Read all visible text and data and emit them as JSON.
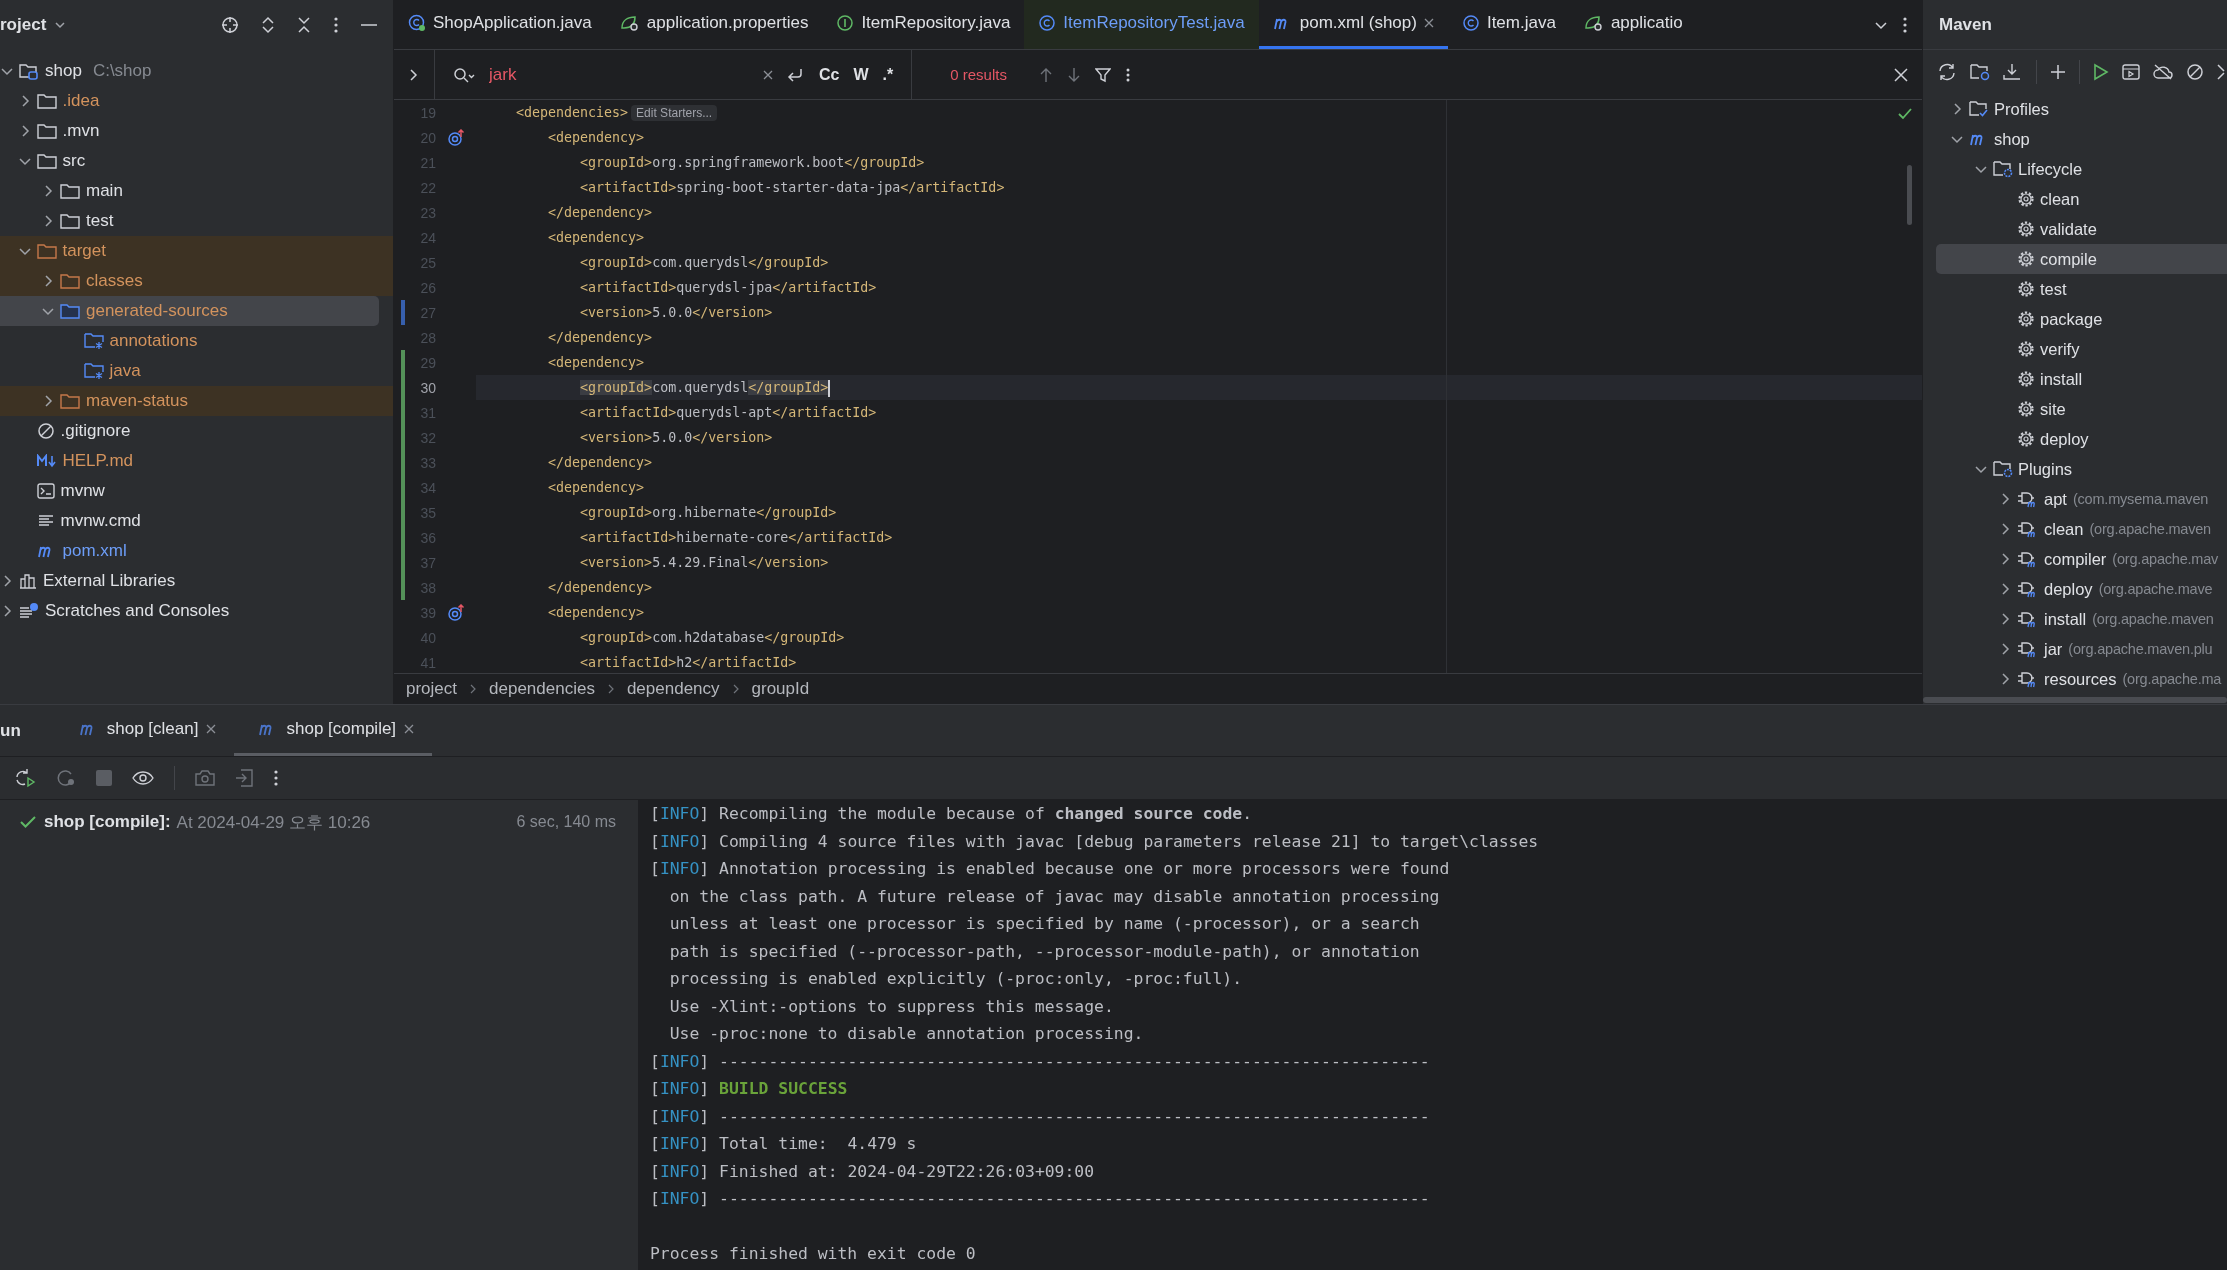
{
  "project": {
    "title": "roject",
    "tree": [
      {
        "name": "shop",
        "path": "C:\\shop",
        "kind": "module",
        "ignored": false,
        "modified": false,
        "expanded": true,
        "selected": false,
        "excluded": false,
        "children": [
          {
            "name": ".idea",
            "kind": "folder",
            "ignored": true,
            "modified": false,
            "expanded": false,
            "selected": false,
            "excluded": false
          },
          {
            "name": ".mvn",
            "kind": "folder",
            "ignored": false,
            "modified": false,
            "expanded": false,
            "selected": false,
            "excluded": false
          },
          {
            "name": "src",
            "kind": "folder",
            "ignored": false,
            "modified": false,
            "expanded": true,
            "selected": false,
            "excluded": false,
            "children": [
              {
                "name": "main",
                "kind": "folder",
                "ignored": false,
                "modified": false,
                "expanded": false,
                "selected": false,
                "excluded": false
              },
              {
                "name": "test",
                "kind": "folder",
                "ignored": false,
                "modified": false,
                "expanded": false,
                "selected": false,
                "excluded": false
              }
            ]
          },
          {
            "name": "target",
            "kind": "excluded-folder",
            "ignored": true,
            "modified": false,
            "expanded": true,
            "selected": false,
            "excluded": true,
            "children": [
              {
                "name": "classes",
                "kind": "excluded-folder",
                "ignored": true,
                "modified": false,
                "expanded": false,
                "selected": false,
                "excluded": true
              },
              {
                "name": "generated-sources",
                "kind": "source-folder",
                "ignored": true,
                "modified": false,
                "expanded": true,
                "selected": true,
                "excluded": false,
                "children": [
                  {
                    "name": "annotations",
                    "kind": "generated-root",
                    "ignored": true,
                    "modified": false,
                    "selected": false,
                    "excluded": false
                  },
                  {
                    "name": "java",
                    "kind": "generated-root",
                    "ignored": true,
                    "modified": false,
                    "selected": false,
                    "excluded": false
                  }
                ]
              },
              {
                "name": "maven-status",
                "kind": "excluded-folder",
                "ignored": true,
                "modified": false,
                "expanded": false,
                "selected": false,
                "excluded": true
              }
            ]
          },
          {
            "name": ".gitignore",
            "kind": "ignore-file",
            "ignored": false,
            "modified": false,
            "selected": false,
            "excluded": false
          },
          {
            "name": "HELP.md",
            "kind": "markdown",
            "ignored": true,
            "modified": false,
            "selected": false,
            "excluded": false
          },
          {
            "name": "mvnw",
            "kind": "script",
            "ignored": false,
            "modified": false,
            "selected": false,
            "excluded": false
          },
          {
            "name": "mvnw.cmd",
            "kind": "text-file",
            "ignored": false,
            "modified": false,
            "selected": false,
            "excluded": false
          },
          {
            "name": "pom.xml",
            "kind": "maven",
            "ignored": false,
            "modified": true,
            "selected": false,
            "excluded": false
          }
        ]
      },
      {
        "name": "External Libraries",
        "kind": "libraries",
        "ignored": false,
        "modified": false,
        "expanded": false,
        "selected": false,
        "excluded": false
      },
      {
        "name": "Scratches and Consoles",
        "kind": "scratches",
        "ignored": false,
        "modified": false,
        "expanded": false,
        "selected": false,
        "excluded": false
      }
    ]
  },
  "editor": {
    "tabs": [
      {
        "label": "ShopApplication.java",
        "kind": "spring-class",
        "selected": false,
        "test": false
      },
      {
        "label": "application.properties",
        "kind": "properties",
        "selected": false,
        "test": false
      },
      {
        "label": "ItemRepository.java",
        "kind": "interface",
        "selected": false,
        "test": false
      },
      {
        "label": "ItemRepositoryTest.java",
        "kind": "class",
        "selected": false,
        "test": true
      },
      {
        "label": "pom.xml (shop)",
        "kind": "maven",
        "selected": true,
        "test": false
      },
      {
        "label": "Item.java",
        "kind": "class",
        "selected": false,
        "test": false
      },
      {
        "label": "applicatio",
        "kind": "properties",
        "selected": false,
        "test": false
      }
    ],
    "find": {
      "query": "jark",
      "options": [
        "Cc",
        "W",
        ".*"
      ],
      "results": "0 results"
    },
    "lines": [
      {
        "number": "19",
        "text": "    <dependencies>",
        "inlay": "Edit Starters...",
        "current": false,
        "added": false,
        "modified": false,
        "marker": false
      },
      {
        "number": "20",
        "text": "        <dependency>",
        "current": false,
        "added": false,
        "modified": false,
        "marker": true
      },
      {
        "number": "21",
        "text": "            <groupId>org.springframework.boot</groupId>",
        "current": false,
        "added": false,
        "modified": false,
        "marker": false
      },
      {
        "number": "22",
        "text": "            <artifactId>spring-boot-starter-data-jpa</artifactId>",
        "current": false,
        "added": false,
        "modified": false,
        "marker": false
      },
      {
        "number": "23",
        "text": "        </dependency>",
        "current": false,
        "added": false,
        "modified": false,
        "marker": false
      },
      {
        "number": "24",
        "text": "        <dependency>",
        "current": false,
        "added": false,
        "modified": false,
        "marker": false
      },
      {
        "number": "25",
        "text": "            <groupId>com.querydsl</groupId>",
        "current": false,
        "added": false,
        "modified": false,
        "marker": false
      },
      {
        "number": "26",
        "text": "            <artifactId>querydsl-jpa</artifactId>",
        "current": false,
        "added": false,
        "modified": false,
        "marker": false
      },
      {
        "number": "27",
        "text": "            <version>5.0.0</version>",
        "current": false,
        "added": false,
        "modified": true,
        "marker": false
      },
      {
        "number": "28",
        "text": "        </dependency>",
        "current": false,
        "added": false,
        "modified": false,
        "marker": false
      },
      {
        "number": "29",
        "text": "        <dependency>",
        "current": false,
        "added": true,
        "modified": false,
        "marker": false
      },
      {
        "number": "30",
        "text": "            <groupId>com.querydsl</groupId>",
        "current": true,
        "added": true,
        "modified": false,
        "marker": false
      },
      {
        "number": "31",
        "text": "            <artifactId>querydsl-apt</artifactId>",
        "current": false,
        "added": true,
        "modified": false,
        "marker": false
      },
      {
        "number": "32",
        "text": "            <version>5.0.0</version>",
        "current": false,
        "added": true,
        "modified": false,
        "marker": false
      },
      {
        "number": "33",
        "text": "        </dependency>",
        "current": false,
        "added": true,
        "modified": false,
        "marker": false
      },
      {
        "number": "34",
        "text": "        <dependency>",
        "current": false,
        "added": true,
        "modified": false,
        "marker": false
      },
      {
        "number": "35",
        "text": "            <groupId>org.hibernate</groupId>",
        "current": false,
        "added": true,
        "modified": false,
        "marker": false
      },
      {
        "number": "36",
        "text": "            <artifactId>hibernate-core</artifactId>",
        "current": false,
        "added": true,
        "modified": false,
        "marker": false
      },
      {
        "number": "37",
        "text": "            <version>5.4.29.Final</version>",
        "current": false,
        "added": true,
        "modified": false,
        "marker": false
      },
      {
        "number": "38",
        "text": "        </dependency>",
        "current": false,
        "added": true,
        "modified": false,
        "marker": false
      },
      {
        "number": "39",
        "text": "        <dependency>",
        "current": false,
        "added": false,
        "modified": false,
        "marker": true
      },
      {
        "number": "40",
        "text": "            <groupId>com.h2database</groupId>",
        "current": false,
        "added": false,
        "modified": false,
        "marker": false
      },
      {
        "number": "41",
        "text": "            <artifactId>h2</artifactId>",
        "current": false,
        "added": false,
        "modified": false,
        "marker": false
      }
    ],
    "breadcrumbs": [
      "project",
      "dependencies",
      "dependency",
      "groupId"
    ]
  },
  "maven": {
    "title": "Maven",
    "tree": [
      {
        "name": "Profiles",
        "kind": "profiles",
        "expanded": false,
        "selected": false
      },
      {
        "name": "shop",
        "kind": "maven-project",
        "expanded": true,
        "selected": false,
        "children": [
          {
            "name": "Lifecycle",
            "kind": "lifecycle",
            "expanded": true,
            "selected": false,
            "children": [
              {
                "name": "clean",
                "kind": "goal",
                "selected": false
              },
              {
                "name": "validate",
                "kind": "goal",
                "selected": false
              },
              {
                "name": "compile",
                "kind": "goal",
                "selected": true
              },
              {
                "name": "test",
                "kind": "goal",
                "selected": false
              },
              {
                "name": "package",
                "kind": "goal",
                "selected": false
              },
              {
                "name": "verify",
                "kind": "goal",
                "selected": false
              },
              {
                "name": "install",
                "kind": "goal",
                "selected": false
              },
              {
                "name": "site",
                "kind": "goal",
                "selected": false
              },
              {
                "name": "deploy",
                "kind": "goal",
                "selected": false
              }
            ]
          },
          {
            "name": "Plugins",
            "kind": "lifecycle",
            "expanded": true,
            "selected": false,
            "children": [
              {
                "name": "apt",
                "detail": "(com.mysema.maven",
                "kind": "plugin",
                "expanded": false,
                "selected": false
              },
              {
                "name": "clean",
                "detail": "(org.apache.maven",
                "kind": "plugin",
                "expanded": false,
                "selected": false
              },
              {
                "name": "compiler",
                "detail": "(org.apache.mav",
                "kind": "plugin",
                "expanded": false,
                "selected": false
              },
              {
                "name": "deploy",
                "detail": "(org.apache.mave",
                "kind": "plugin",
                "expanded": false,
                "selected": false
              },
              {
                "name": "install",
                "detail": "(org.apache.maven",
                "kind": "plugin",
                "expanded": false,
                "selected": false
              },
              {
                "name": "jar",
                "detail": "(org.apache.maven.plu",
                "kind": "plugin",
                "expanded": false,
                "selected": false
              },
              {
                "name": "resources",
                "detail": "(org.apache.ma",
                "kind": "plugin",
                "expanded": false,
                "selected": false
              }
            ]
          }
        ]
      }
    ]
  },
  "run": {
    "title": "un",
    "tabs": [
      {
        "label": "shop [clean]",
        "selected": false
      },
      {
        "label": "shop [compile]",
        "selected": true
      }
    ],
    "result": {
      "name": "shop [compile]:",
      "detail": "At 2024-04-29 오후 10:26",
      "duration": "6 sec, 140 ms",
      "succeeded": true
    },
    "console": [
      {
        "prefix": "[INFO]",
        "text": "Recompiling the module because of **changed source code**.",
        "kind": "plain"
      },
      {
        "prefix": "[INFO]",
        "text": "Compiling 4 source files with javac [debug parameters release 21] to target\\classes",
        "kind": "plain"
      },
      {
        "prefix": "[INFO]",
        "text": "Annotation processing is enabled because one or more processors were found",
        "kind": "plain"
      },
      {
        "text": "  on the class path. A future release of javac may disable annotation processing",
        "kind": "plain"
      },
      {
        "text": "  unless at least one processor is specified by name (-processor), or a search",
        "kind": "plain"
      },
      {
        "text": "  path is specified (--processor-path, --processor-module-path), or annotation",
        "kind": "plain"
      },
      {
        "text": "  processing is enabled explicitly (-proc:only, -proc:full).",
        "kind": "plain"
      },
      {
        "text": "  Use -Xlint:-options to suppress this message.",
        "kind": "plain"
      },
      {
        "text": "  Use -proc:none to disable annotation processing.",
        "kind": "plain"
      },
      {
        "prefix": "[INFO]",
        "text": "------------------------------------------------------------------------",
        "kind": "plain"
      },
      {
        "prefix": "[INFO]",
        "text": "BUILD SUCCESS",
        "kind": "success"
      },
      {
        "prefix": "[INFO]",
        "text": "------------------------------------------------------------------------",
        "kind": "plain"
      },
      {
        "prefix": "[INFO]",
        "text": "Total time:  4.479 s",
        "kind": "plain"
      },
      {
        "prefix": "[INFO]",
        "text": "Finished at: 2024-04-29T22:26:03+09:00",
        "kind": "plain"
      },
      {
        "prefix": "[INFO]",
        "text": "------------------------------------------------------------------------",
        "kind": "plain"
      }
    ],
    "exit_message": "Process finished with exit code 0"
  }
}
